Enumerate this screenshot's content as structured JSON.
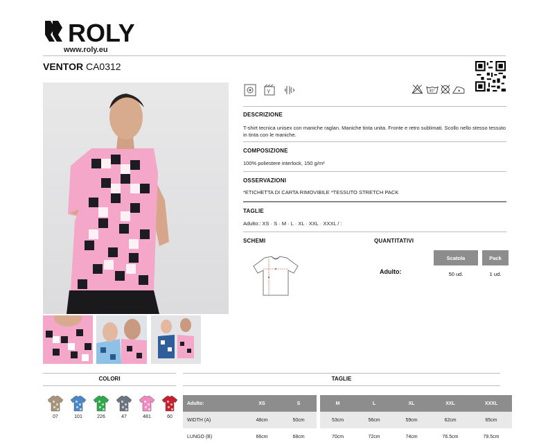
{
  "brand": {
    "logo_text": "ROLY",
    "url": "www.roly.eu"
  },
  "product": {
    "name": "VENTOR",
    "code": "CA0312"
  },
  "sections": {
    "descrizione": {
      "title": "DESCRIZIONE",
      "text": "T-shirt tecnica unisex con maniche raglan. Maniche tinta unita. Fronte e retro sublimati. Scollo nello stesso tessuto in tinta con le maniche."
    },
    "composizione": {
      "title": "COMPOSIZIONE",
      "text": "100% poliestere interlock, 150 g/m²"
    },
    "osservazioni": {
      "title": "OSSERVAZIONI",
      "text": "*ETICHETTA DI CARTA RIMOVIBILE *TESSUTO STRETCH PACK"
    },
    "taglie": {
      "title": "TAGLIE",
      "text": "Adulto:: XS · S · M · L · XL · XXL · XXXL / :"
    },
    "schemi": {
      "title": "SCHEMI"
    },
    "quantitativi": {
      "title": "QUANTITATIVI",
      "headers": [
        "Scatola",
        "Pack"
      ],
      "row_label": "Adulto:",
      "values": [
        "50 ud.",
        "1 ud."
      ]
    }
  },
  "care_label": "40°",
  "colori": {
    "title": "COLORI",
    "items": [
      {
        "code": "07",
        "color": "#a89478"
      },
      {
        "code": "101",
        "color": "#4a86c8"
      },
      {
        "code": "226",
        "color": "#2ea84a"
      },
      {
        "code": "47",
        "color": "#6a7580"
      },
      {
        "code": "481",
        "color": "#f08ac0"
      },
      {
        "code": "60",
        "color": "#c81e2e"
      }
    ]
  },
  "taglie_table": {
    "title": "TAGLIE",
    "headers": [
      "Adulto:",
      "XS",
      "S",
      "M",
      "L",
      "XL",
      "XXL",
      "XXXL"
    ],
    "rows": [
      {
        "label": "WIDTH (A)",
        "values": [
          "48cm",
          "50cm",
          "53cm",
          "56cm",
          "59cm",
          "62cm",
          "65cm"
        ]
      },
      {
        "label": "LUNGO (B)",
        "values": [
          "66cm",
          "68cm",
          "70cm",
          "72cm",
          "74cm",
          "76.5cm",
          "79.5cm"
        ]
      }
    ]
  }
}
